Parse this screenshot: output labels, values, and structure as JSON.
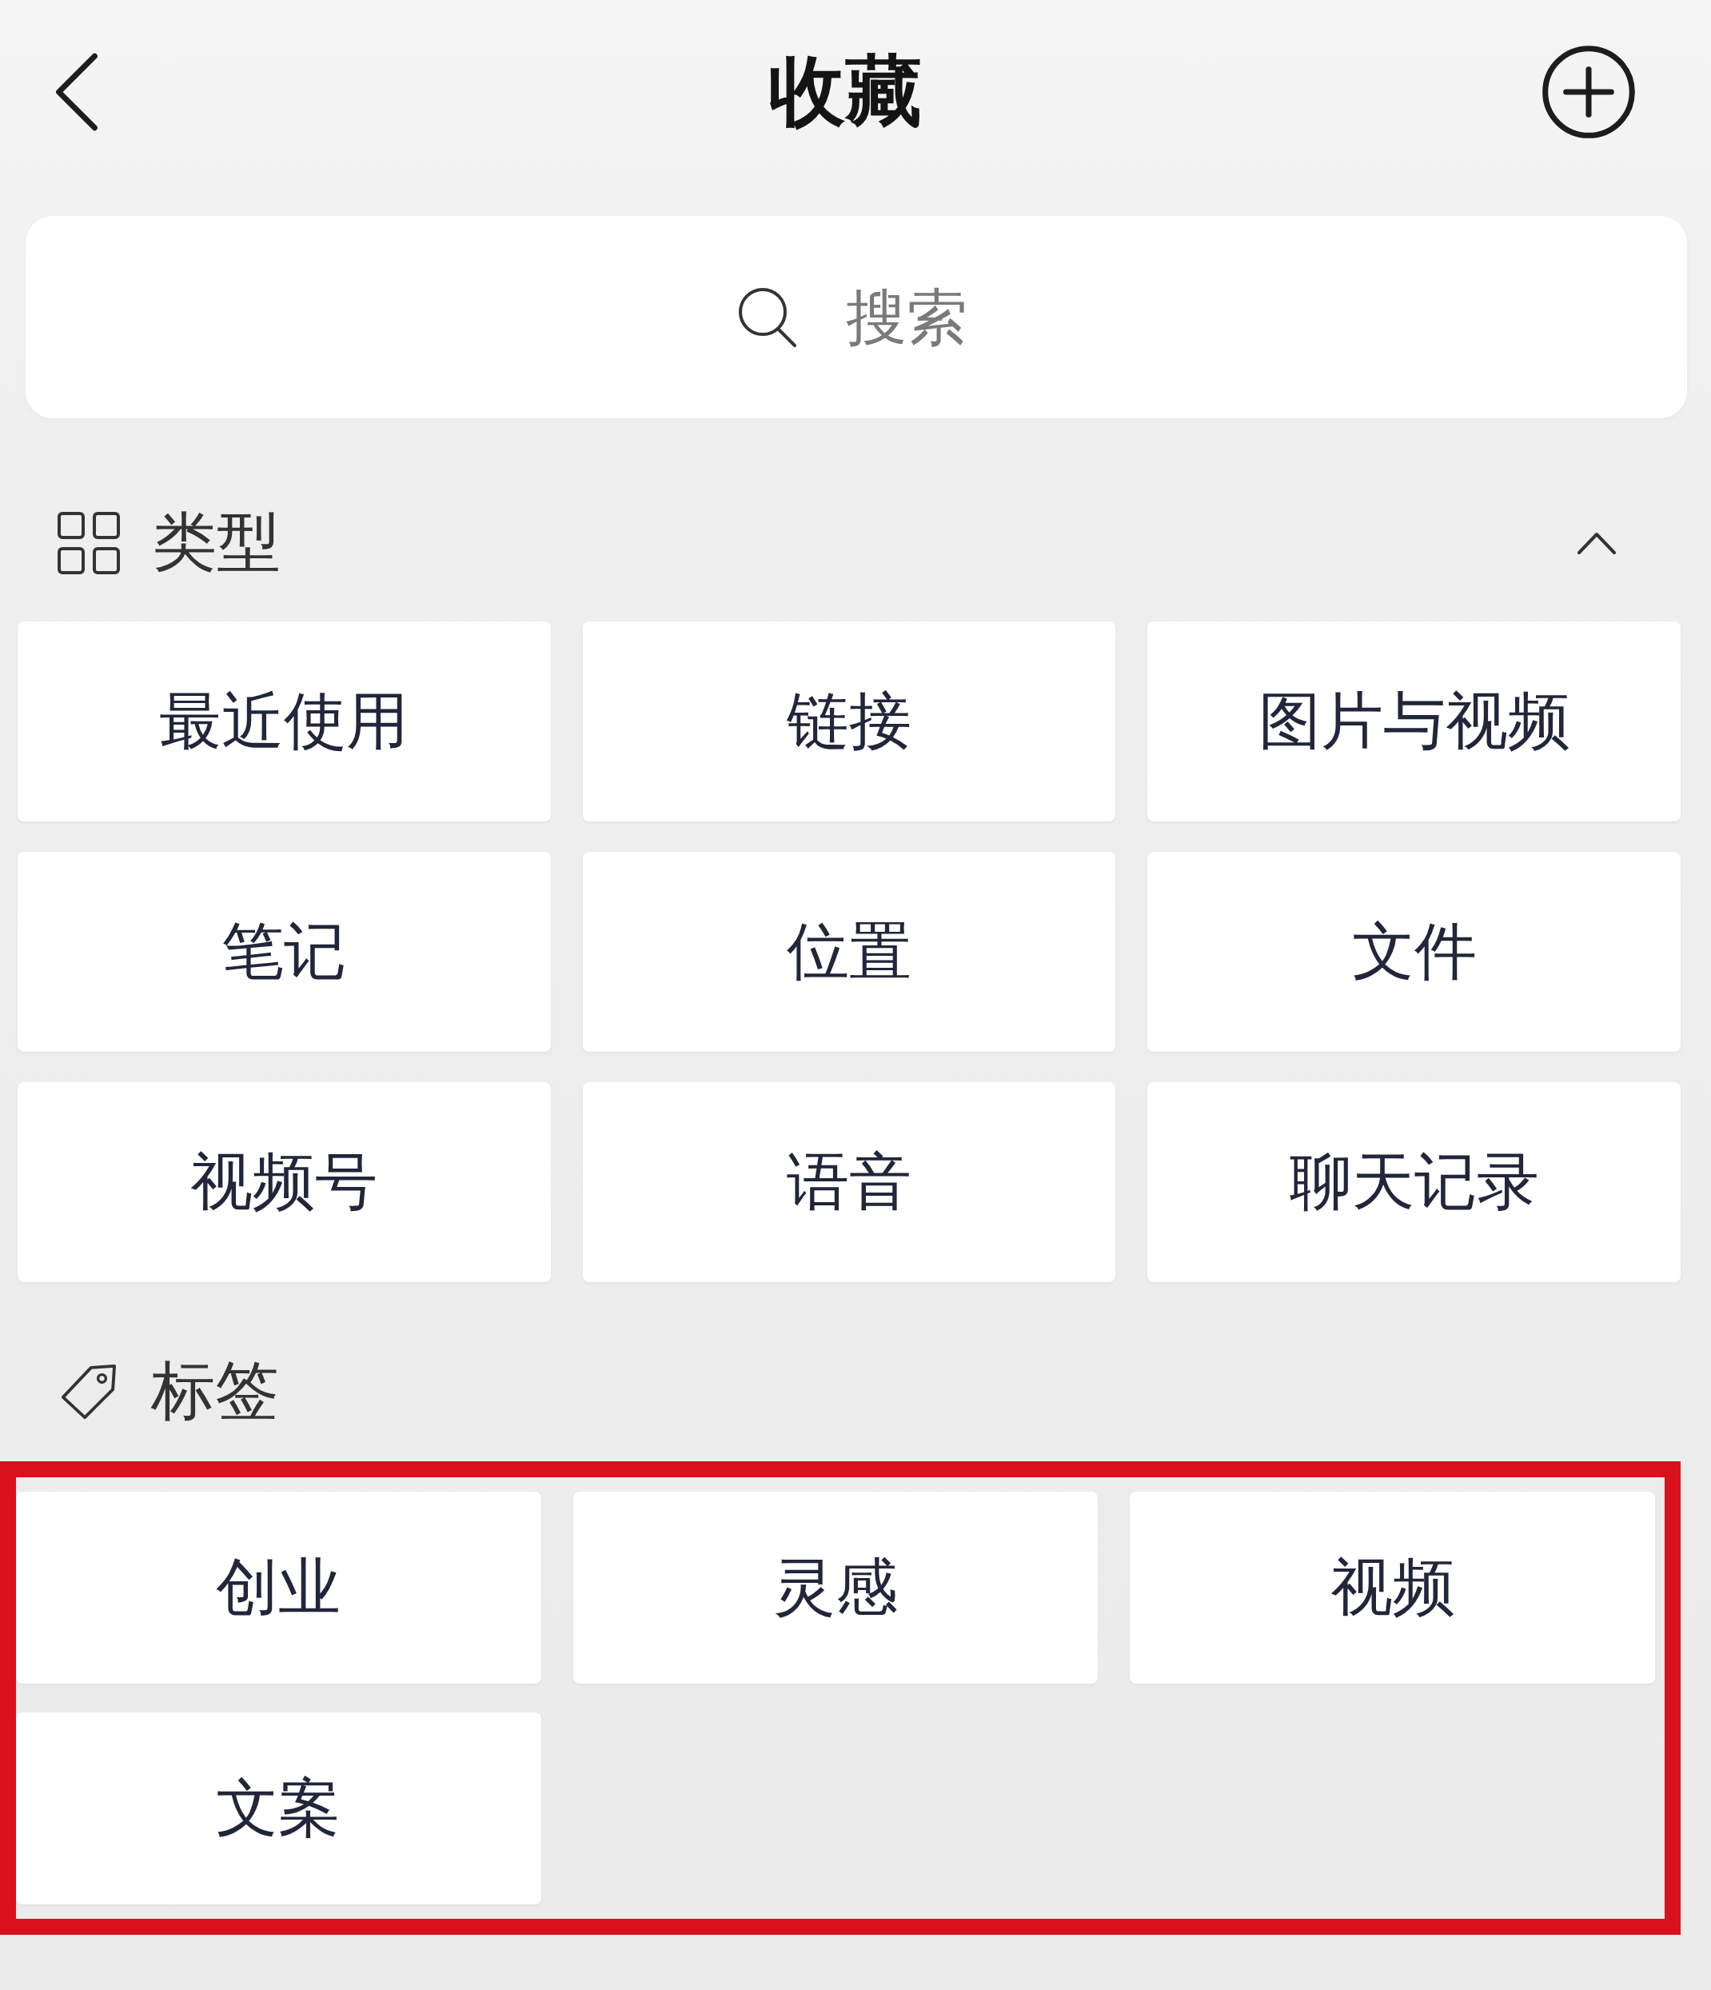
{
  "header": {
    "title": "收藏"
  },
  "search": {
    "placeholder": "搜索"
  },
  "types": {
    "title": "类型",
    "expanded": true,
    "items": [
      "最近使用",
      "链接",
      "图片与视频",
      "笔记",
      "位置",
      "文件",
      "视频号",
      "语音",
      "聊天记录"
    ]
  },
  "tags": {
    "title": "标签",
    "highlighted": true,
    "items": [
      "创业",
      "灵感",
      "视频",
      "文案"
    ]
  }
}
